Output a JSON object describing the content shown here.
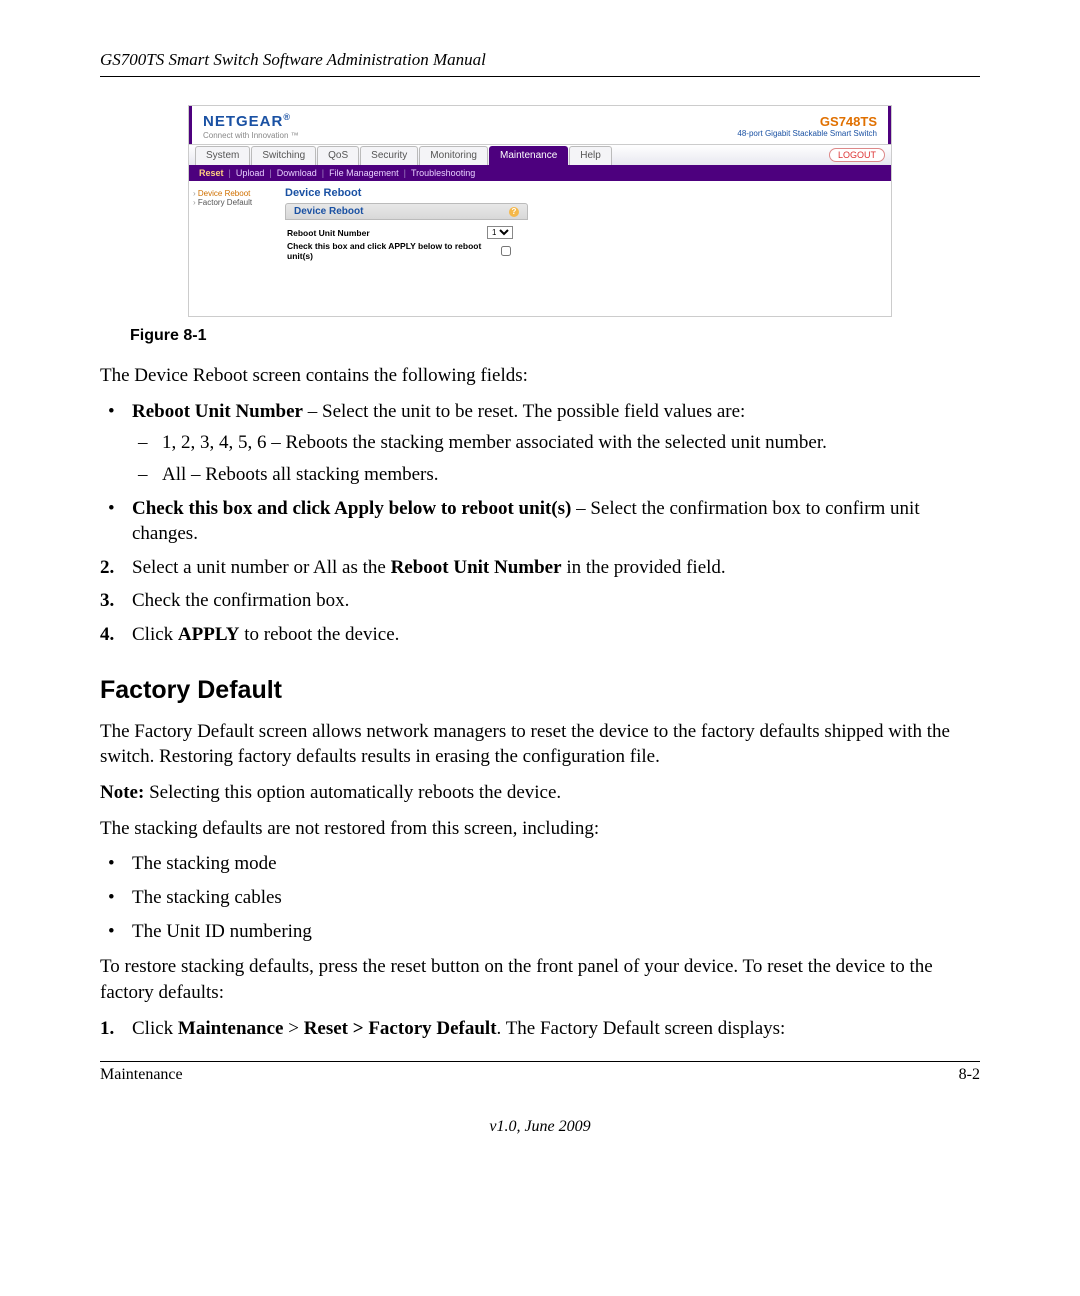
{
  "doc": {
    "header": "GS700TS Smart Switch Software Administration Manual",
    "figure_caption": "Figure 8-1",
    "intro": "The Device Reboot screen contains the following fields:",
    "bullet1_b": "Reboot Unit Number",
    "bullet1_rest": " – Select the unit to be reset. The possible field values are:",
    "sub1": "1, 2, 3, 4, 5, 6 – Reboots the stacking member associated with the selected unit number.",
    "sub2": "All – Reboots all stacking members.",
    "bullet2_b": "Check this box and click Apply below to reboot unit(s)",
    "bullet2_rest": " – Select the confirmation box to confirm unit changes.",
    "step2_a": "Select a unit number or All as the ",
    "step2_b": "Reboot Unit Number",
    "step2_c": " in the provided field.",
    "step3": "Check the confirmation box.",
    "step4_a": "Click ",
    "step4_b": "APPLY",
    "step4_c": " to reboot the device.",
    "section_heading": "Factory Default",
    "fd_p1": "The Factory Default screen allows network managers to reset the device to the factory defaults shipped with the switch. Restoring factory defaults results in erasing the configuration file.",
    "fd_note_b": "Note:",
    "fd_note_rest": " Selecting this option automatically reboots the device.",
    "fd_p2": "The stacking defaults are not restored from this screen, including:",
    "fd_li1": "The stacking mode",
    "fd_li2": "The stacking cables",
    "fd_li3": "The Unit ID numbering",
    "fd_p3": "To restore stacking defaults, press the reset button on the front panel of your device.  To reset the device to the factory defaults:",
    "fd_step1_a": "Click ",
    "fd_step1_b": "Maintenance",
    "fd_step1_c": " > ",
    "fd_step1_d": "Reset > Factory Default",
    "fd_step1_e": ". The Factory Default screen displays:",
    "footer_left": "Maintenance",
    "footer_right": "8-2",
    "footer_version": "v1.0, June 2009",
    "num2": "2.",
    "num3": "3.",
    "num4": "4.",
    "num1": "1."
  },
  "ui": {
    "brand": "NETGEAR",
    "brand_tagline": "Connect with Innovation ™",
    "model": "GS748TS",
    "model_sub": "48-port Gigabit Stackable Smart Switch",
    "tabs": [
      "System",
      "Switching",
      "QoS",
      "Security",
      "Monitoring",
      "Maintenance",
      "Help"
    ],
    "active_tab": "Maintenance",
    "logout": "LOGOUT",
    "subtabs": [
      "Reset",
      "Upload",
      "Download",
      "File Management",
      "Troubleshooting"
    ],
    "active_subtab": "Reset",
    "side_items": [
      "Device Reboot",
      "Factory Default"
    ],
    "side_active": "Device Reboot",
    "panel_title": "Device Reboot",
    "panel_sub": "Device Reboot",
    "field1": "Reboot Unit Number",
    "field1_value": "1",
    "field2": "Check this box and click APPLY below to reboot unit(s)"
  }
}
